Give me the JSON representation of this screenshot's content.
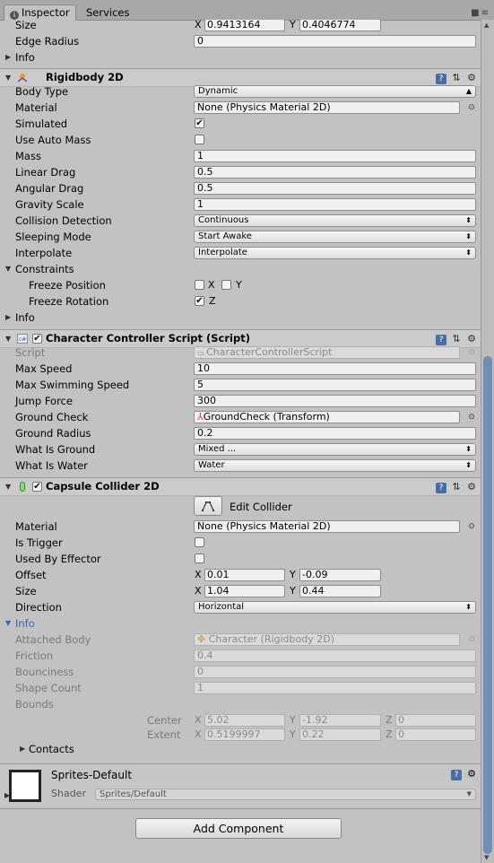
{
  "tabs": {
    "inspector": "Inspector",
    "services": "Services",
    "info_glyph": "i"
  },
  "prev": {
    "size_label": "Size",
    "size_x": "0.9413164",
    "size_y": "0.4046774",
    "edge_radius_label": "Edge Radius",
    "edge_radius": "0",
    "info_label": "Info"
  },
  "axis": {
    "x": "X",
    "y": "Y",
    "z": "Z"
  },
  "rb": {
    "title": "Rigidbody 2D",
    "body_type_label": "Body Type",
    "body_type": "Dynamic",
    "material_label": "Material",
    "material": "None (Physics Material 2D)",
    "simulated_label": "Simulated",
    "use_auto_mass_label": "Use Auto Mass",
    "mass_label": "Mass",
    "mass": "1",
    "linear_drag_label": "Linear Drag",
    "linear_drag": "0.5",
    "angular_drag_label": "Angular Drag",
    "angular_drag": "0.5",
    "gravity_scale_label": "Gravity Scale",
    "gravity_scale": "1",
    "collision_label": "Collision Detection",
    "collision": "Continuous",
    "sleeping_label": "Sleeping Mode",
    "sleeping": "Start Awake",
    "interpolate_label": "Interpolate",
    "interpolate": "Interpolate",
    "constraints_label": "Constraints",
    "freeze_pos_label": "Freeze Position",
    "freeze_rot_label": "Freeze Rotation",
    "info_label": "Info"
  },
  "script": {
    "title": "Character Controller Script (Script)",
    "script_label": "Script",
    "script": "CharacterControllerScript",
    "max_speed_label": "Max Speed",
    "max_speed": "10",
    "max_swim_label": "Max Swimming Speed",
    "max_swim": "5",
    "jump_label": "Jump Force",
    "jump": "300",
    "ground_check_label": "Ground Check",
    "ground_check": "GroundCheck (Transform)",
    "ground_radius_label": "Ground Radius",
    "ground_radius": "0.2",
    "what_ground_label": "What Is Ground",
    "what_ground": "Mixed ...",
    "what_water_label": "What Is Water",
    "what_water": "Water"
  },
  "capsule": {
    "title": "Capsule Collider 2D",
    "edit_label": "Edit Collider",
    "material_label": "Material",
    "material": "None (Physics Material 2D)",
    "is_trigger_label": "Is Trigger",
    "used_by_effector_label": "Used By Effector",
    "offset_label": "Offset",
    "offset_x": "0.01",
    "offset_y": "-0.09",
    "size_label": "Size",
    "size_x": "1.04",
    "size_y": "0.44",
    "direction_label": "Direction",
    "direction": "Horizontal",
    "info_label": "Info",
    "attached_label": "Attached Body",
    "attached": "Character (Rigidbody 2D)",
    "friction_label": "Friction",
    "friction": "0.4",
    "bounciness_label": "Bounciness",
    "bounciness": "0",
    "shape_count_label": "Shape Count",
    "shape_count": "1",
    "bounds_label": "Bounds",
    "center_label": "Center",
    "center_x": "5.02",
    "center_y": "-1.92",
    "center_z": "0",
    "extent_label": "Extent",
    "extent_x": "0.5199997",
    "extent_y": "0.22",
    "extent_z": "0",
    "contacts_label": "Contacts"
  },
  "material": {
    "name": "Sprites-Default",
    "shader_label": "Shader",
    "shader": "Sprites/Default"
  },
  "add_component": "Add Component",
  "checkbox_glyph": "✔",
  "colors": {
    "panel": "#c2c2c2",
    "scroll_thumb": "#6f8fb8",
    "info_blue": "#3b63b8"
  }
}
